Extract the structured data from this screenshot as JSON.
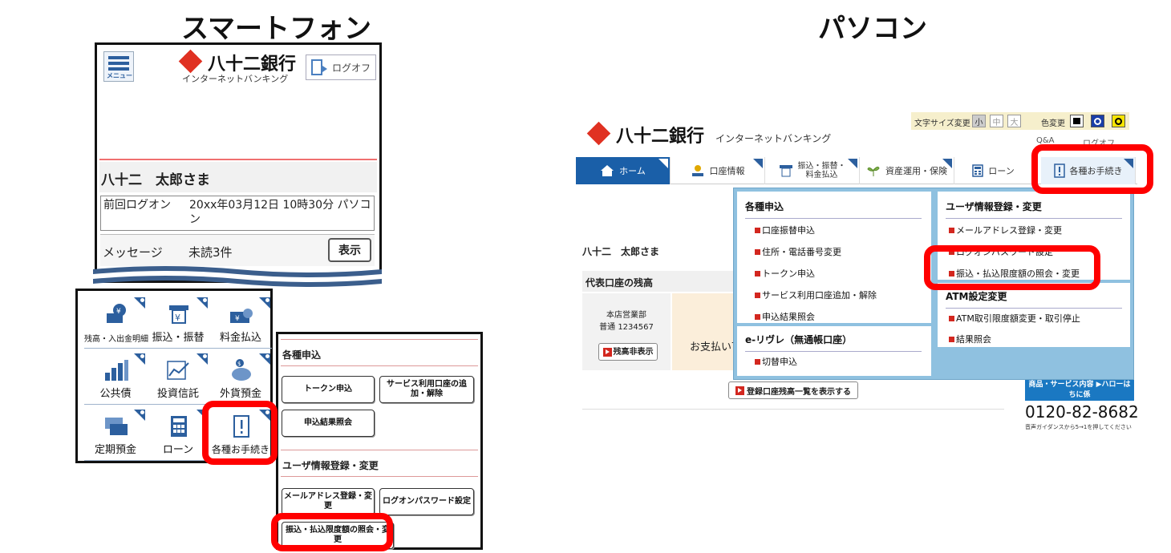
{
  "titles": {
    "smartphone": "スマートフォン",
    "pc": "パソコン"
  },
  "bank": {
    "name": "八十二銀行",
    "subtitle": "インターネットバンキング"
  },
  "phone": {
    "menu_label": "メニュー",
    "logoff_label": "ログオフ",
    "user_name": "八十二　太郎さま",
    "last_logon_label": "前回ログオン",
    "last_logon_value": "20xx年03月12日 10時30分 パソコン",
    "message_label": "メッセージ",
    "message_value": "未読3件",
    "show_button": "表示",
    "grid": [
      {
        "label": "残高・入出金明細",
        "icon": "balance-icon"
      },
      {
        "label": "振込・振替",
        "icon": "transfer-icon"
      },
      {
        "label": "料金払込",
        "icon": "payment-icon"
      },
      {
        "label": "公共債",
        "icon": "bond-icon"
      },
      {
        "label": "投資信託",
        "icon": "investment-icon"
      },
      {
        "label": "外貨預金",
        "icon": "piggybank-icon"
      },
      {
        "label": "定期預金",
        "icon": "deposit-icon"
      },
      {
        "label": "ローン",
        "icon": "calculator-icon"
      },
      {
        "label": "各種お手続き",
        "icon": "procedures-icon"
      }
    ],
    "submenu": {
      "apply_title": "各種申込",
      "token": "トークン申込",
      "service_account": "サービス利用口座の追加・解除",
      "apply_result": "申込結果照会",
      "user_title": "ユーザ情報登録・変更",
      "mail": "メールアドレス登録・変更",
      "password": "ログオンパスワード設定",
      "limit": "振込・払込限度額の照会・変更"
    }
  },
  "pc": {
    "fontsize_label": "文字サイズ変更",
    "fontsize_small": "小",
    "fontsize_mid": "中",
    "fontsize_large": "大",
    "color_label": "色変更",
    "qa_label": "Q&A",
    "logoff_label": "ログオフ",
    "nav": [
      {
        "label": "ホーム"
      },
      {
        "label": "口座情報"
      },
      {
        "label": "振込・振替・料金払込"
      },
      {
        "label": "資産運用・保険"
      },
      {
        "label": "ローン"
      },
      {
        "label": "各種お手続き"
      }
    ],
    "user_name": "八十二　太郎さま",
    "balance_title": "代表口座の残高",
    "branch": "本店営業部",
    "account": "普通 1234567",
    "hide_balance": "残高非表示",
    "pay_text": "お支払い可",
    "list_button": "登録口座残高一覧を表示する",
    "dropdown": {
      "apply_title": "各種申込",
      "apply_items": [
        "口座振替申込",
        "住所・電話番号変更",
        "トークン申込",
        "サービス利用口座追加・解除",
        "申込結果照会"
      ],
      "erive_title": "e-リヴレ（無通帳口座）",
      "erive_items": [
        "切替申込"
      ],
      "user_title": "ユーザ情報登録・変更",
      "user_items": [
        "メールアドレス登録・変更",
        "ログオンパスワード設定",
        "振込・払込限度額の照会・変更"
      ],
      "atm_title": "ATM設定変更",
      "atm_items": [
        "ATM取引限度額変更・取引停止",
        "結果照会"
      ]
    },
    "side_badge": "商品・サービス内容 ▶ハローはちに係",
    "phone_number": "0120-82-8682",
    "phone_note": "音声ガイダンスから5→1を押してください"
  },
  "colors": {
    "highlight": "#ff0000",
    "brand_red": "#e03122",
    "nav_blue": "#1a5fa8",
    "dropdown_bg": "#8fc1e0"
  }
}
